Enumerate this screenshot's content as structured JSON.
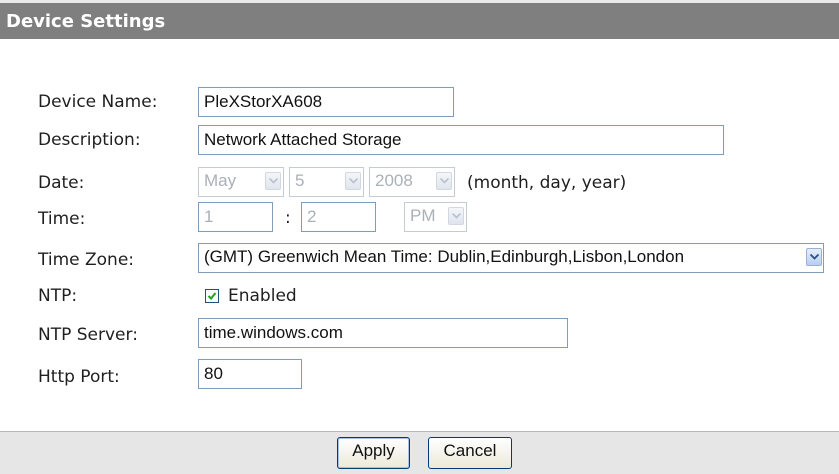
{
  "header": {
    "title": "Device Settings"
  },
  "form": {
    "device_name": {
      "label": "Device Name:",
      "value": "PleXStorXA608"
    },
    "description": {
      "label": "Description:",
      "value": "Network Attached Storage"
    },
    "date": {
      "label": "Date:",
      "month": "May",
      "day": "5",
      "year": "2008",
      "hint": "(month, day, year)"
    },
    "time": {
      "label": "Time:",
      "hour": "1",
      "separator": ":",
      "minute": "2",
      "ampm": "PM"
    },
    "time_zone": {
      "label": "Time Zone:",
      "value": "(GMT) Greenwich Mean Time: Dublin,Edinburgh,Lisbon,London"
    },
    "ntp": {
      "label": "NTP:",
      "checkbox_label": "Enabled",
      "checked": true
    },
    "ntp_server": {
      "label": "NTP Server:",
      "value": "time.windows.com"
    },
    "http_port": {
      "label": "Http Port:",
      "value": "80"
    }
  },
  "footer": {
    "apply_label": "Apply",
    "cancel_label": "Cancel"
  },
  "colors": {
    "header_bg": "#7f7f7f",
    "header_text": "#ffffff",
    "footer_bg": "#e6e6e6",
    "disabled_text": "#aab0b8"
  },
  "icons": {
    "select_arrow": "chevron-down-icon",
    "checkbox_check": "checkmark-icon"
  }
}
